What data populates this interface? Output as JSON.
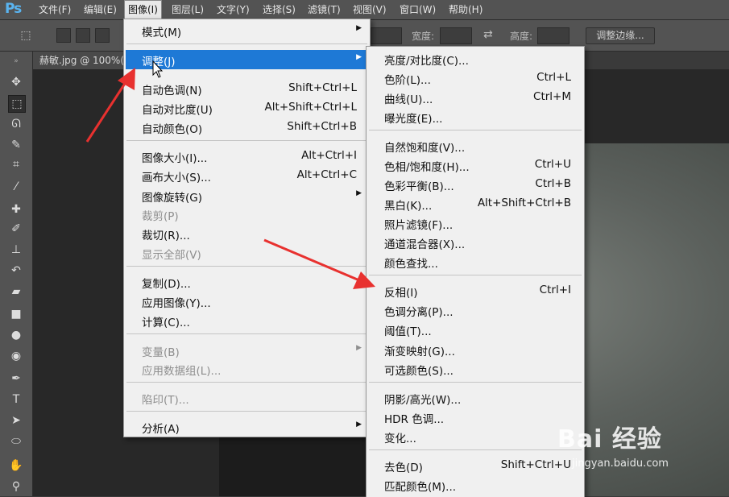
{
  "menubar": {
    "logo": "Ps",
    "items": [
      "文件(F)",
      "编辑(E)",
      "图像(I)",
      "图层(L)",
      "文字(Y)",
      "选择(S)",
      "滤镜(T)",
      "视图(V)",
      "窗口(W)",
      "帮助(H)"
    ],
    "active_index": 2
  },
  "optionsbar": {
    "width_label": "宽度:",
    "height_label": "高度:",
    "refine_label": "调整边缘..."
  },
  "document": {
    "tab_title": "赫敏.jpg @ 100%("
  },
  "image_menu": {
    "items": [
      {
        "label": "模式(M)",
        "shortcut": "",
        "submenu": true,
        "disabled": false
      },
      {
        "label": "调整(J)",
        "shortcut": "",
        "submenu": true,
        "disabled": false,
        "highlighted": true
      },
      {
        "label": "自动色调(N)",
        "shortcut": "Shift+Ctrl+L"
      },
      {
        "label": "自动对比度(U)",
        "shortcut": "Alt+Shift+Ctrl+L"
      },
      {
        "label": "自动颜色(O)",
        "shortcut": "Shift+Ctrl+B"
      },
      {
        "label": "图像大小(I)...",
        "shortcut": "Alt+Ctrl+I"
      },
      {
        "label": "画布大小(S)...",
        "shortcut": "Alt+Ctrl+C"
      },
      {
        "label": "图像旋转(G)",
        "shortcut": "",
        "submenu": true
      },
      {
        "label": "裁剪(P)",
        "shortcut": "",
        "disabled": true
      },
      {
        "label": "裁切(R)...",
        "shortcut": ""
      },
      {
        "label": "显示全部(V)",
        "shortcut": "",
        "disabled": true
      },
      {
        "label": "复制(D)...",
        "shortcut": ""
      },
      {
        "label": "应用图像(Y)...",
        "shortcut": ""
      },
      {
        "label": "计算(C)...",
        "shortcut": ""
      },
      {
        "label": "变量(B)",
        "shortcut": "",
        "submenu": true,
        "disabled": true
      },
      {
        "label": "应用数据组(L)...",
        "shortcut": "",
        "disabled": true
      },
      {
        "label": "陷印(T)...",
        "shortcut": "",
        "disabled": true
      },
      {
        "label": "分析(A)",
        "shortcut": "",
        "submenu": true
      }
    ]
  },
  "adjust_menu": {
    "items": [
      {
        "label": "亮度/对比度(C)...",
        "shortcut": ""
      },
      {
        "label": "色阶(L)...",
        "shortcut": "Ctrl+L"
      },
      {
        "label": "曲线(U)...",
        "shortcut": "Ctrl+M"
      },
      {
        "label": "曝光度(E)...",
        "shortcut": ""
      },
      {
        "label": "自然饱和度(V)...",
        "shortcut": ""
      },
      {
        "label": "色相/饱和度(H)...",
        "shortcut": "Ctrl+U"
      },
      {
        "label": "色彩平衡(B)...",
        "shortcut": "Ctrl+B"
      },
      {
        "label": "黑白(K)...",
        "shortcut": "Alt+Shift+Ctrl+B"
      },
      {
        "label": "照片滤镜(F)...",
        "shortcut": ""
      },
      {
        "label": "通道混合器(X)...",
        "shortcut": ""
      },
      {
        "label": "颜色查找...",
        "shortcut": ""
      },
      {
        "label": "反相(I)",
        "shortcut": "Ctrl+I"
      },
      {
        "label": "色调分离(P)...",
        "shortcut": ""
      },
      {
        "label": "阈值(T)...",
        "shortcut": ""
      },
      {
        "label": "渐变映射(G)...",
        "shortcut": ""
      },
      {
        "label": "可选颜色(S)...",
        "shortcut": ""
      },
      {
        "label": "阴影/高光(W)...",
        "shortcut": ""
      },
      {
        "label": "HDR 色调...",
        "shortcut": ""
      },
      {
        "label": "变化...",
        "shortcut": ""
      },
      {
        "label": "去色(D)",
        "shortcut": "Shift+Ctrl+U"
      },
      {
        "label": "匹配颜色(M)...",
        "shortcut": ""
      }
    ]
  },
  "watermark": {
    "logo": "Bai 经验",
    "url": "jingyan.baidu.com"
  },
  "colors": {
    "highlight": "#1e79d6",
    "arrow": "#e8312f",
    "menu_bg": "#f0f0f0"
  }
}
